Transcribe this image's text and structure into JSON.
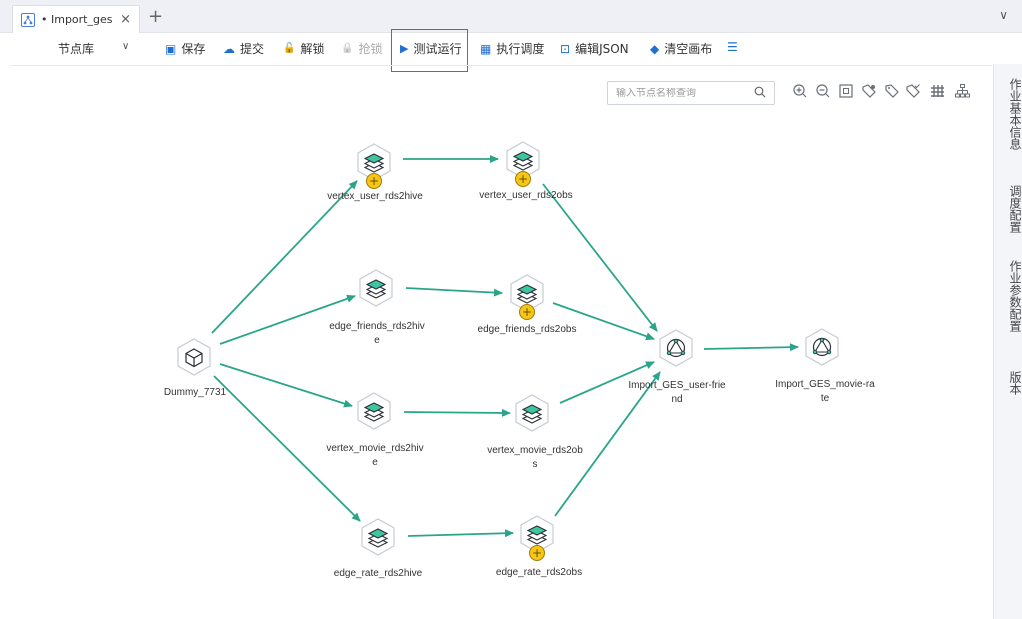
{
  "tab": {
    "title": "• Import_ges",
    "close": "×",
    "add": "+",
    "menu": "∨"
  },
  "toolbar": {
    "library": "节点库",
    "library_chevron": "∨",
    "items": [
      {
        "label": "保存",
        "icon": "save-icon",
        "glyph": "▣"
      },
      {
        "label": "提交",
        "icon": "cloud-upload-icon",
        "glyph": "☁"
      },
      {
        "label": "解锁",
        "icon": "unlock-icon",
        "glyph": "🔓"
      },
      {
        "label": "抢锁",
        "icon": "lock-icon",
        "glyph": "🔒"
      },
      {
        "label": "测试运行",
        "icon": "play-icon",
        "glyph": "▶"
      },
      {
        "label": "执行调度",
        "icon": "schedule-icon",
        "glyph": "▦"
      },
      {
        "label": "编辑JSON",
        "icon": "json-icon",
        "glyph": "⊡"
      },
      {
        "label": "清空画布",
        "icon": "eraser-icon",
        "glyph": "◆"
      },
      {
        "label": "",
        "icon": "menu-icon",
        "glyph": "☰"
      }
    ]
  },
  "search": {
    "placeholder": "输入节点名称查询",
    "icon": "search-icon"
  },
  "canvas_tools": [
    "zoom-in-icon",
    "zoom-out-icon",
    "fit-icon",
    "tag-icon",
    "tag-outline-icon",
    "tag-check-icon",
    "grid-icon",
    "layout-icon"
  ],
  "right_panel": [
    "作业基本信息",
    "调度配置",
    "作业参数配置",
    "版本"
  ],
  "nodes": [
    {
      "id": "dummy",
      "label": "Dummy_7731",
      "type": "dummy"
    },
    {
      "id": "vu_hive",
      "label": "vertex_user_rds2hive",
      "type": "cdm",
      "badge": true
    },
    {
      "id": "ef_hive",
      "label": "edge_friends_rds2hive",
      "type": "cdm"
    },
    {
      "id": "vm_hive",
      "label": "vertex_movie_rds2hive",
      "type": "cdm"
    },
    {
      "id": "er_hive",
      "label": "edge_rate_rds2hive",
      "type": "cdm"
    },
    {
      "id": "vu_obs",
      "label": "vertex_user_rds2obs",
      "type": "cdm",
      "badge": true
    },
    {
      "id": "ef_obs",
      "label": "edge_friends_rds2obs",
      "type": "cdm",
      "badge": true
    },
    {
      "id": "vm_obs",
      "label": "vertex_movie_rds2obs",
      "type": "cdm"
    },
    {
      "id": "er_obs",
      "label": "edge_rate_rds2obs",
      "type": "cdm",
      "badge": true
    },
    {
      "id": "ges_uf",
      "label": "Import_GES_user-friend",
      "type": "ges"
    },
    {
      "id": "ges_mr",
      "label": "Import_GES_movie-rate",
      "type": "ges"
    }
  ],
  "label_lines": {
    "ef_hive": [
      "edge_friends_rds2hiv",
      "e"
    ],
    "vm_hive": [
      "vertex_movie_rds2hiv",
      "e"
    ],
    "vm_obs": [
      "vertex_movie_rds2ob",
      "s"
    ],
    "ges_uf": [
      "Import_GES_user-frie",
      "nd"
    ],
    "ges_mr": [
      "Import_GES_movie-ra",
      "te"
    ]
  },
  "badge_glyph": "+",
  "colors": {
    "edge": "#2aa58a",
    "highlight": "#e53935",
    "accent": "#1f6fd1"
  }
}
